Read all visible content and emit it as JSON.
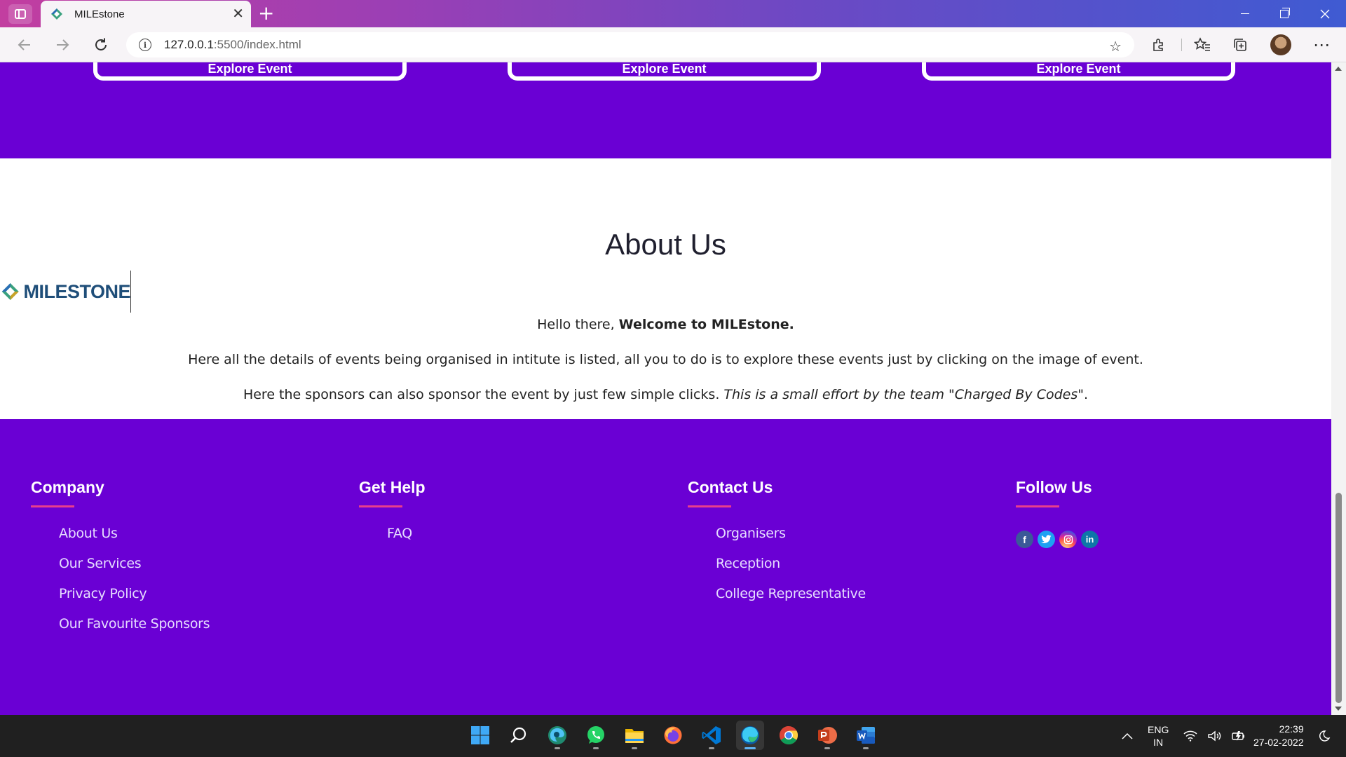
{
  "browser": {
    "tab_title": "MILEstone",
    "url_host": "127.0.0.1",
    "url_rest": ":5500/index.html"
  },
  "events": {
    "button_label": "Explore Event"
  },
  "about": {
    "title": "About Us",
    "logo_text": "MILESTONE",
    "p1_prefix": "Hello there, ",
    "p1_bold": "Welcome to MILEstone.",
    "p2": "Here all the details of events being organised in intitute is listed, all you to do is to explore these events just by clicking on the image of event.",
    "p3_prefix": "Here the sponsors can also sponsor the event by just few simple clicks. ",
    "p3_italic": "This is a small effort by the team \"Charged By Codes\"",
    "p3_suffix": "."
  },
  "footer": {
    "columns": [
      {
        "heading": "Company",
        "links": [
          "About Us",
          "Our Services",
          "Privacy Policy",
          "Our Favourite Sponsors"
        ]
      },
      {
        "heading": "Get Help",
        "links": [
          "FAQ"
        ]
      },
      {
        "heading": "Contact Us",
        "links": [
          "Organisers",
          "Reception",
          "College Representative"
        ]
      },
      {
        "heading": "Follow Us",
        "social": [
          "facebook-icon",
          "twitter-icon",
          "instagram-icon",
          "linkedin-icon"
        ]
      }
    ],
    "social_labels": {
      "facebook": "f",
      "twitter": "t",
      "instagram": "◎",
      "linkedin": "in"
    }
  },
  "colors": {
    "accent_purple": "#6a00d4",
    "underline_pink": "#e83e8c",
    "logo_blue": "#1f4e79"
  },
  "taskbar": {
    "lang_top": "ENG",
    "lang_bottom": "IN",
    "time": "22:39",
    "date": "27-02-2022",
    "apps": [
      "start-icon",
      "search-icon",
      "edge-dev-icon",
      "whatsapp-icon",
      "file-explorer-icon",
      "firefox-icon",
      "vscode-icon",
      "edge-icon",
      "chrome-icon",
      "powerpoint-icon",
      "word-icon"
    ]
  }
}
